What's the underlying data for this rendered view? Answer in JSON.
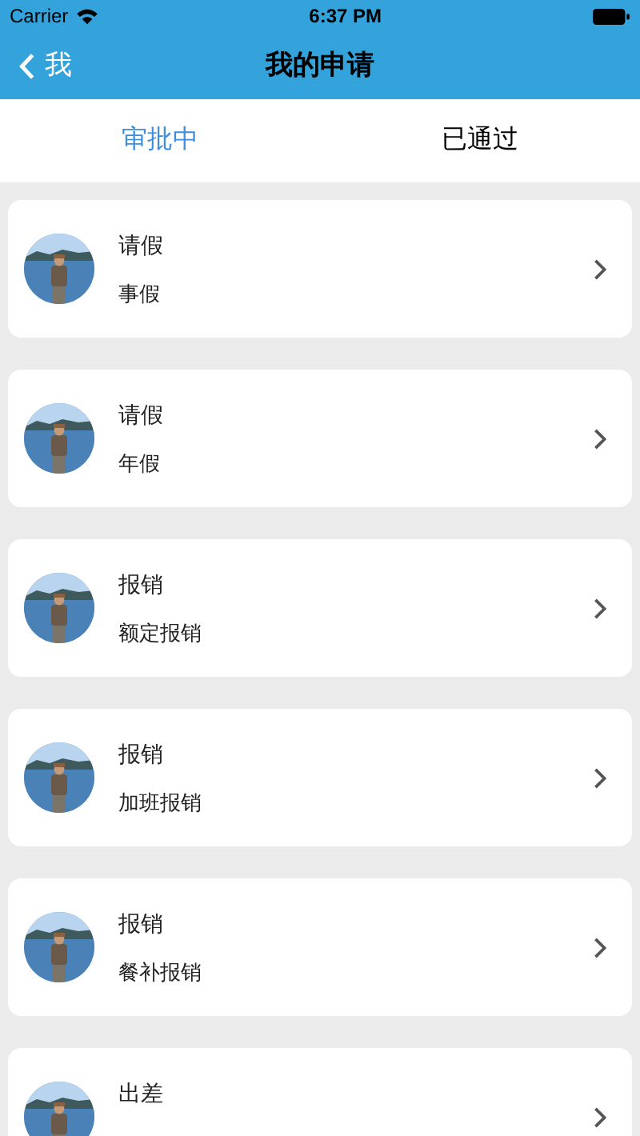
{
  "status_bar": {
    "carrier": "Carrier",
    "time": "6:37 PM"
  },
  "nav": {
    "back_label": "我",
    "title": "我的申请"
  },
  "tabs": [
    {
      "label": "审批中",
      "selected": true
    },
    {
      "label": "已通过",
      "selected": false
    }
  ],
  "items": [
    {
      "title": "请假",
      "subtitle": "事假"
    },
    {
      "title": "请假",
      "subtitle": "年假"
    },
    {
      "title": "报销",
      "subtitle": "额定报销"
    },
    {
      "title": "报销",
      "subtitle": "加班报销"
    },
    {
      "title": "报销",
      "subtitle": "餐补报销"
    },
    {
      "title": "出差"
    }
  ]
}
